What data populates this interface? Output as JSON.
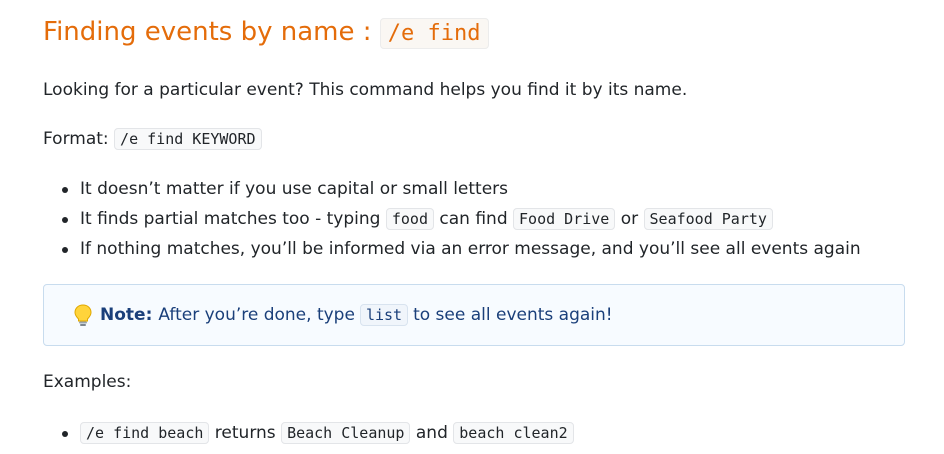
{
  "heading": {
    "text": "Finding events by name : ",
    "code": "/e find"
  },
  "intro": "Looking for a particular event? This command helps you find it by its name.",
  "format": {
    "label": "Format: ",
    "code": "/e find KEYWORD"
  },
  "bullets": {
    "case": "It doesn’t matter if you use capital or small letters",
    "partial_prefix": "It finds partial matches too - typing ",
    "partial_code1": "food",
    "partial_mid": " can find ",
    "partial_code2": "Food Drive",
    "partial_or": " or ",
    "partial_code3": "Seafood Party",
    "nomatch": "If nothing matches, you’ll be informed via an error message, and you’ll see all events again"
  },
  "note": {
    "icon": "lightbulb-icon",
    "label": "Note:",
    "prefix": "After you’re done, type ",
    "code": "list",
    "suffix": " to see all events again!"
  },
  "examples": {
    "label": "Examples:",
    "item": {
      "code1": "/e find beach",
      "text1": " returns ",
      "code2": "Beach Cleanup",
      "text2": " and ",
      "code3": "beach clean2"
    }
  },
  "colors": {
    "heading": "#e46c0a",
    "note_text": "#1a3f7a",
    "note_border": "#c8dcee"
  }
}
